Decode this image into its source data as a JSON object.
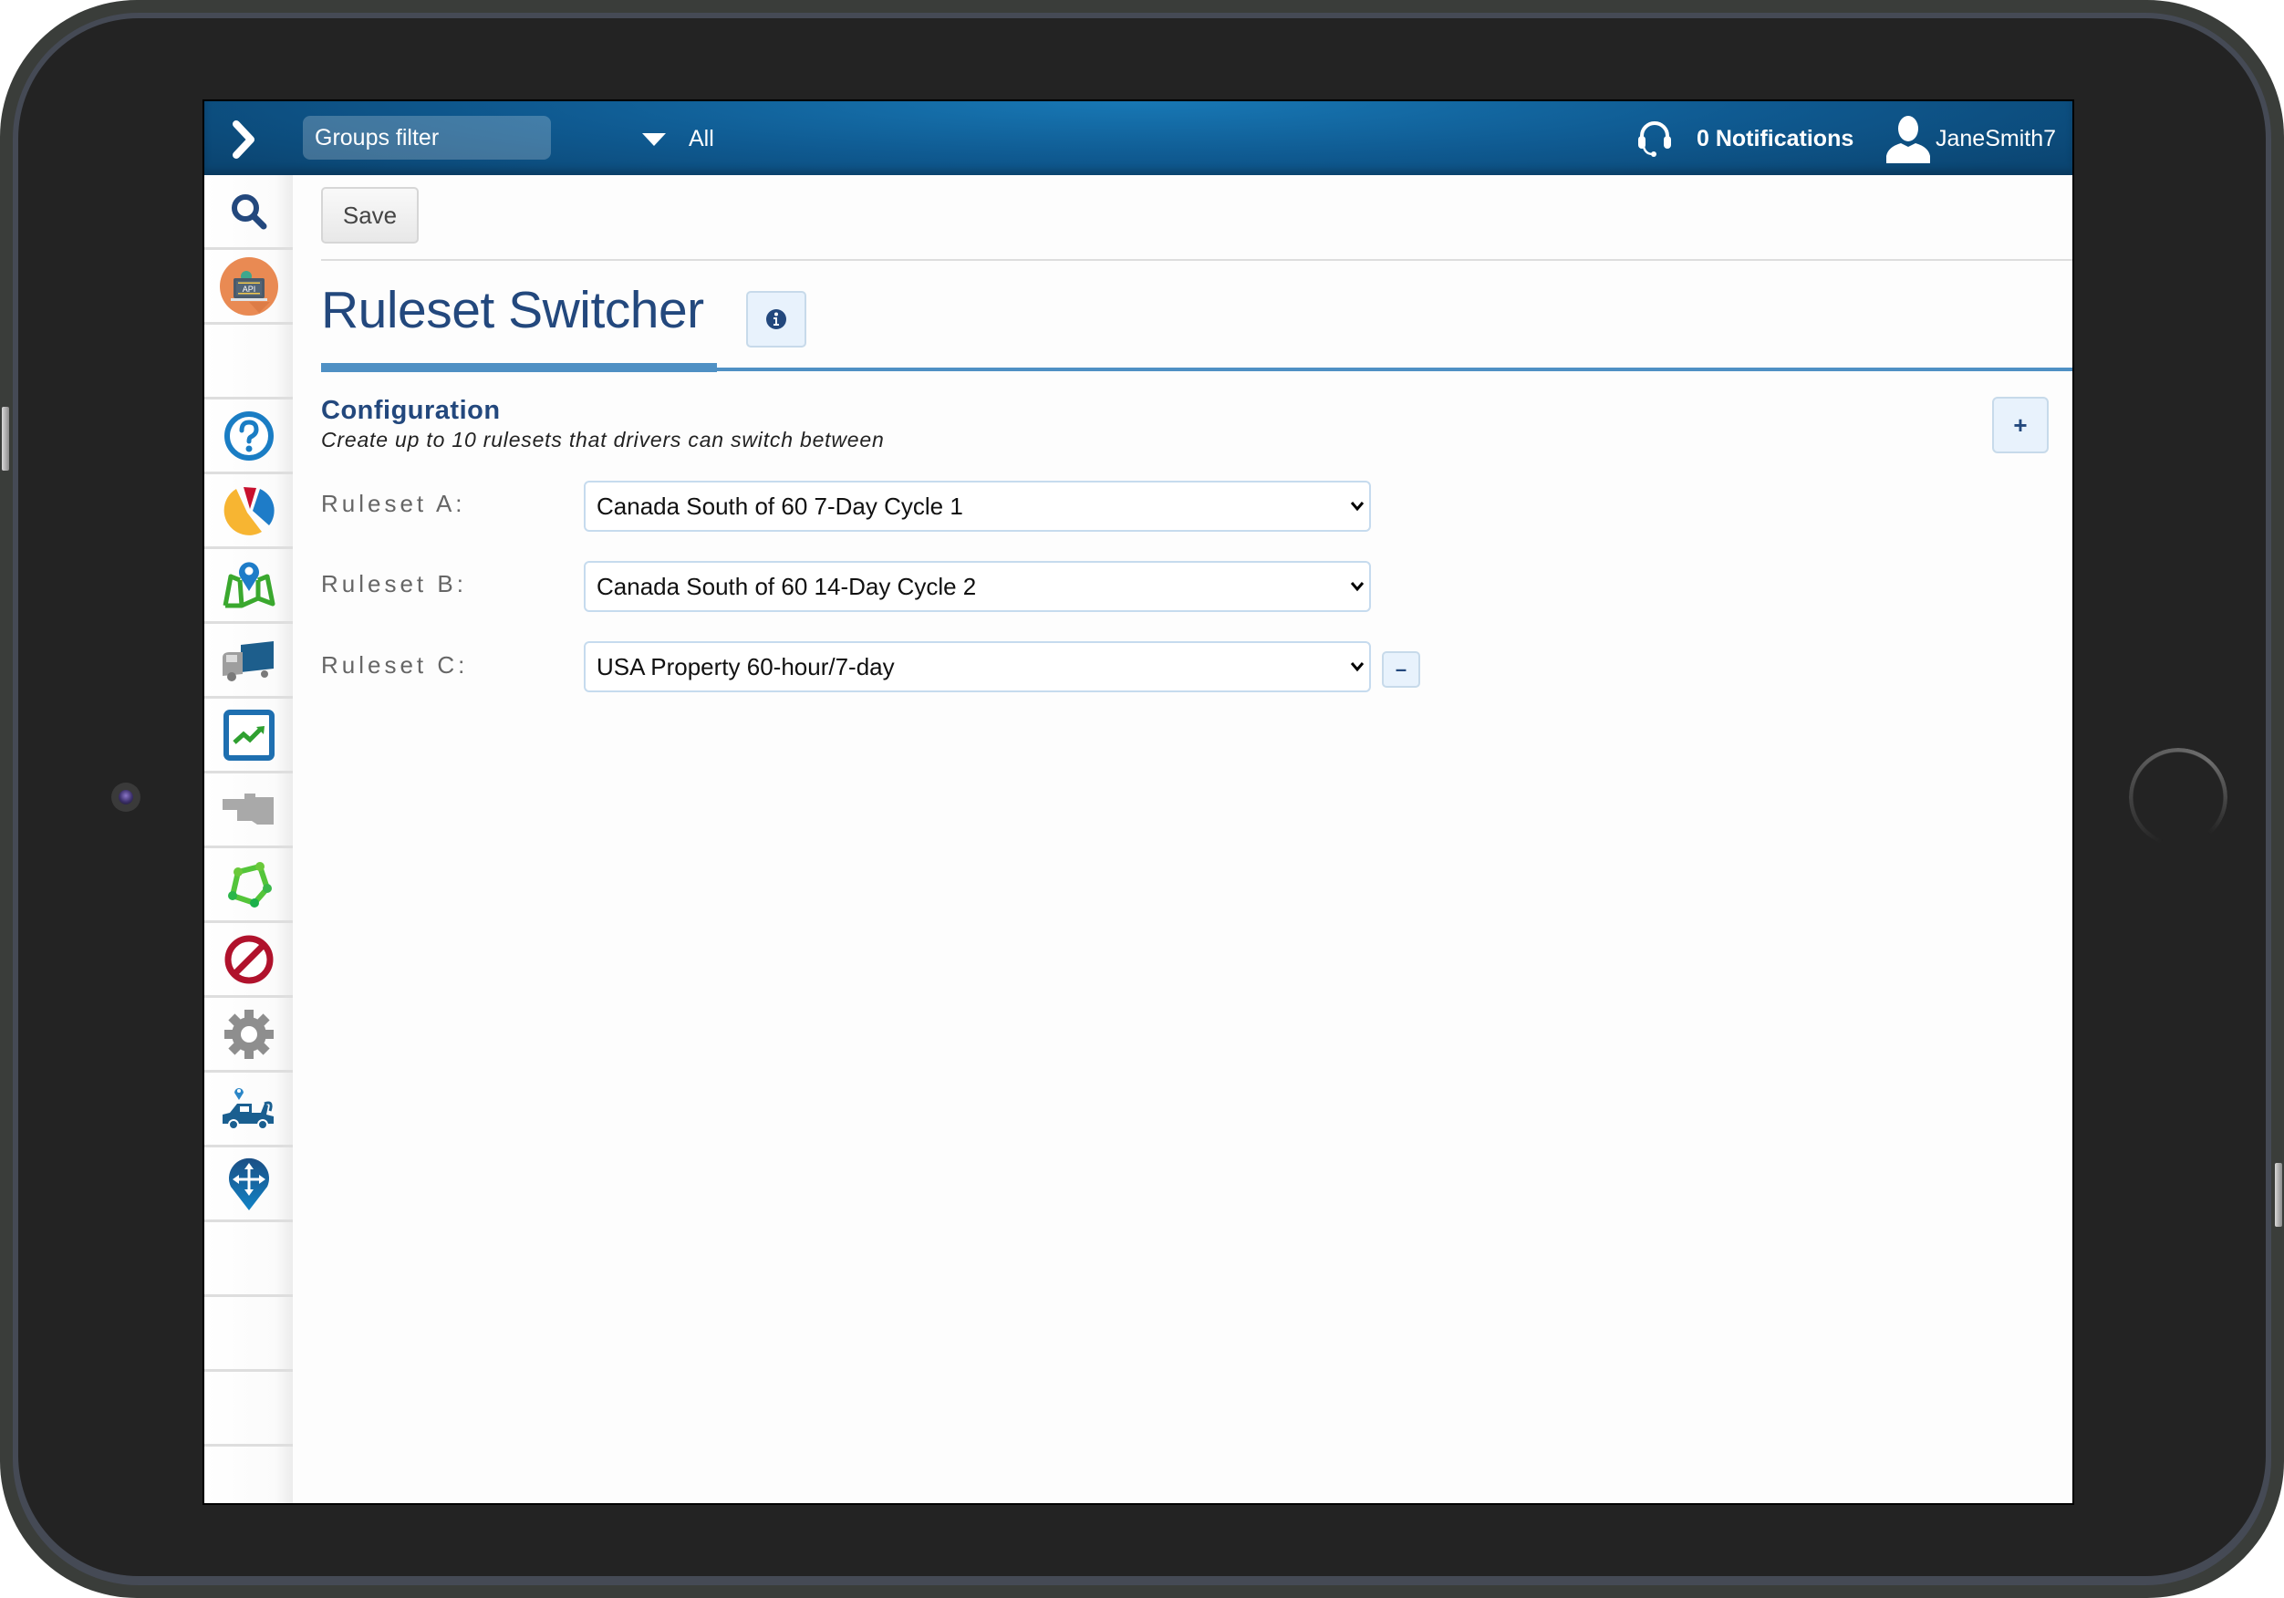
{
  "header": {
    "groups_filter_placeholder": "Groups filter",
    "groups_filter_value": "All",
    "notifications_label": "0 Notifications",
    "username": "JaneSmith7",
    "color": "#0f5a91"
  },
  "sidebar": {
    "items": [
      {
        "icon": "search-icon"
      },
      {
        "icon": "api-icon"
      },
      {
        "icon": "empty"
      },
      {
        "icon": "help-icon"
      },
      {
        "icon": "pie-chart-icon"
      },
      {
        "icon": "map-icon"
      },
      {
        "icon": "truck-icon"
      },
      {
        "icon": "trend-chart-icon"
      },
      {
        "icon": "engine-icon"
      },
      {
        "icon": "zone-icon"
      },
      {
        "icon": "no-entry-icon"
      },
      {
        "icon": "gear-icon"
      },
      {
        "icon": "tow-truck-icon"
      },
      {
        "icon": "move-pin-icon"
      },
      {
        "icon": "empty"
      },
      {
        "icon": "empty"
      },
      {
        "icon": "empty"
      }
    ]
  },
  "toolbar": {
    "save_label": "Save"
  },
  "page": {
    "title": "Ruleset Switcher",
    "accent_color": "#4f90c4",
    "title_color": "#23487d"
  },
  "configuration": {
    "title": "Configuration",
    "subtitle": "Create up to 10 rulesets that drivers can switch between",
    "add_label": "+",
    "remove_label": "–",
    "rulesets": [
      {
        "label": "Ruleset A:",
        "value": "Canada South of 60 7-Day Cycle 1"
      },
      {
        "label": "Ruleset B:",
        "value": "Canada South of 60 14-Day Cycle 2"
      },
      {
        "label": "Ruleset C:",
        "value": "USA Property 60-hour/7-day"
      }
    ]
  }
}
